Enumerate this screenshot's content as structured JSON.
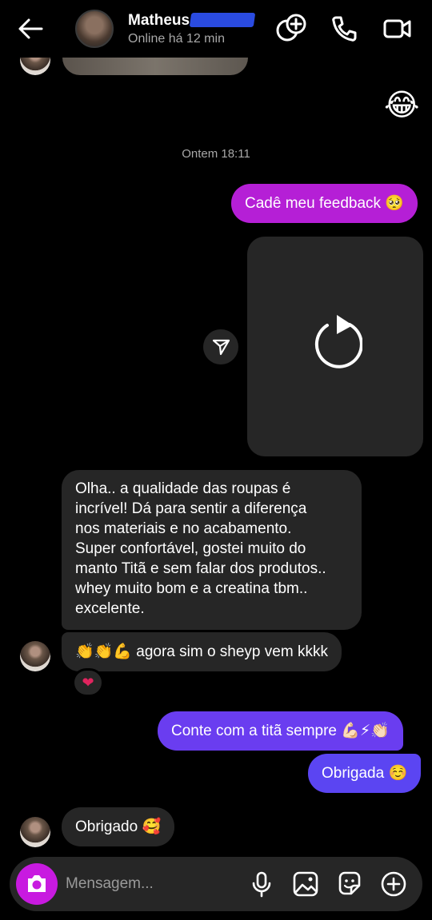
{
  "header": {
    "contact_name": "Matheus",
    "status": "Online há 12 min"
  },
  "chat": {
    "top_emoji": "😂",
    "timestamp": "Ontem 18:11",
    "messages": [
      {
        "side": "out",
        "text": "Cadê meu feedback 🥺",
        "color": "#b51fd6"
      },
      {
        "side": "in",
        "text_lines": [
          "Olha.. a qualidade das roupas é",
          "incrível! Dá para sentir a diferença",
          "nos materiais e no acabamento.",
          "Super confortável, gostei muito do",
          "manto Titã e sem falar dos produtos..",
          "whey muito bom e a creatina tbm..",
          "excelente."
        ]
      },
      {
        "side": "in",
        "text": "👏👏💪 agora sim o sheyp vem kkkk",
        "reaction": "❤"
      },
      {
        "side": "out",
        "text": "Conte com a titã sempre 💪🏻⚡👏🏻",
        "color": "#6a3df0"
      },
      {
        "side": "out",
        "text": "Obrigada ☺️",
        "color": "#5b45f2"
      },
      {
        "side": "in",
        "text": "Obrigado 🥰"
      }
    ]
  },
  "composer": {
    "placeholder": "Mensagem..."
  },
  "colors": {
    "accent_pink": "#c81ae0",
    "bubble_in": "#262626",
    "background": "#000000"
  },
  "icons": [
    "back-arrow-icon",
    "add-people-icon",
    "phone-icon",
    "video-call-icon",
    "share-icon",
    "replay-icon",
    "camera-icon",
    "microphone-icon",
    "gallery-icon",
    "sticker-icon",
    "plus-icon"
  ]
}
